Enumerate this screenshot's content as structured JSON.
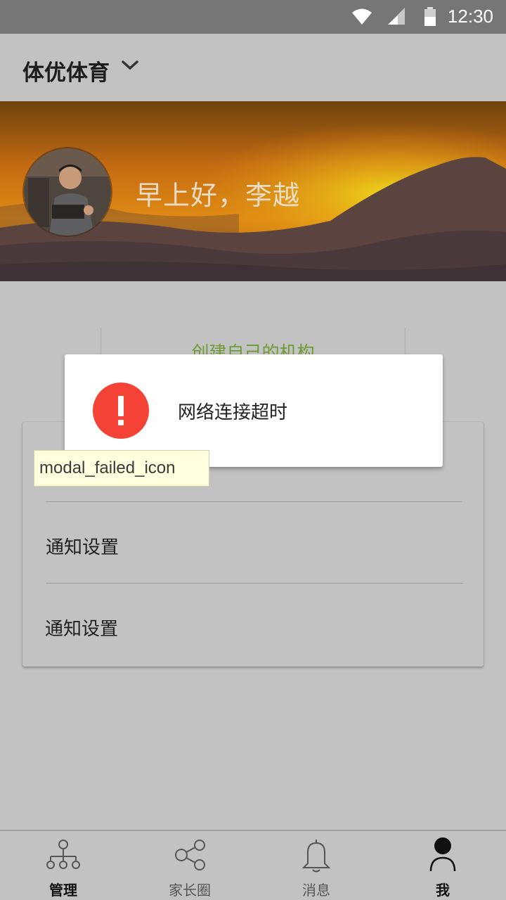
{
  "status_bar": {
    "time": "12:30"
  },
  "app_bar": {
    "org_name": "体优体育"
  },
  "banner": {
    "greeting": "早上好，李越"
  },
  "create_org": {
    "label": "创建自己的机构"
  },
  "settings": {
    "items": [
      {
        "label": "通知设置"
      },
      {
        "label": "通知设置"
      }
    ]
  },
  "modal": {
    "message": "网络连接超时",
    "icon": "error-exclamation-icon",
    "icon_color": "#f44336"
  },
  "tooltip": {
    "text": "modal_failed_icon"
  },
  "bottom_nav": {
    "items": [
      {
        "label": "管理",
        "icon": "org-tree-icon",
        "active": true
      },
      {
        "label": "家长圈",
        "icon": "share-icon",
        "active": false
      },
      {
        "label": "消息",
        "icon": "bell-icon",
        "active": false
      },
      {
        "label": "我",
        "icon": "person-icon",
        "active": true
      }
    ]
  }
}
